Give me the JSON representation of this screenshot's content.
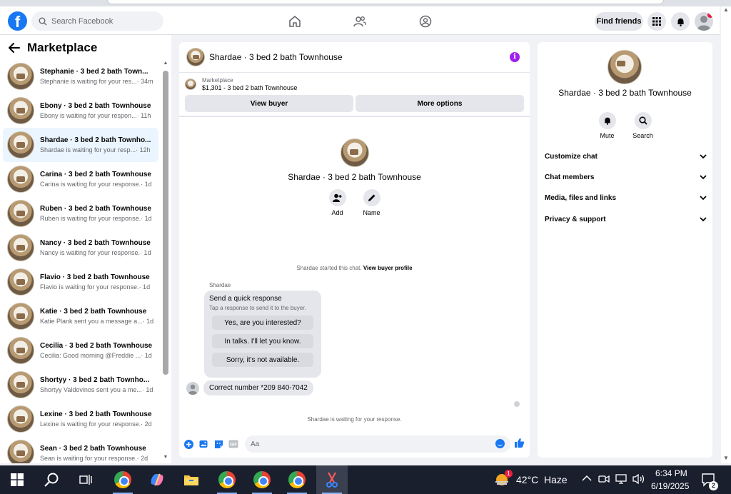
{
  "nav": {
    "search_placeholder": "Search Facebook",
    "logo": "f",
    "find_friends": "Find friends"
  },
  "sidebar": {
    "title": "Marketplace",
    "conversations": [
      {
        "name": "Stephanie · 3 bed 2 bath Town...",
        "msg": "Stephanie is waiting for your res...",
        "time": " · 34m"
      },
      {
        "name": "Ebony · 3 bed 2 bath Townhouse",
        "msg": "Ebony is waiting for your respon...",
        "time": " · 11h"
      },
      {
        "name": "Shardae · 3 bed 2 bath Townho...",
        "msg": "Shardae is waiting for your resp...",
        "time": " · 12h"
      },
      {
        "name": "Carina · 3 bed 2 bath Townhouse",
        "msg": "Carina is waiting for your response.",
        "time": " · 1d"
      },
      {
        "name": "Ruben · 3 bed 2 bath Townhouse",
        "msg": "Ruben is waiting for your response.",
        "time": " · 1d"
      },
      {
        "name": "Nancy · 3 bed 2 bath Townhouse",
        "msg": "Nancy is waiting for your response.",
        "time": " · 1d"
      },
      {
        "name": "Flavio · 3 bed 2 bath Townhouse",
        "msg": "Flavio is waiting for your response.",
        "time": " · 1d"
      },
      {
        "name": "Katie · 3 bed 2 bath Townhouse",
        "msg": "Katie Plank sent you a message a...",
        "time": " · 1d"
      },
      {
        "name": "Cecilia · 3 bed 2 bath Townhouse",
        "msg": "Cecilia: Good morning @Freddie ...",
        "time": " · 1d"
      },
      {
        "name": "Shortyy · 3 bed 2 bath Townho...",
        "msg": "Shortyy Valdovinos sent you a me...",
        "time": " · 1d"
      },
      {
        "name": "Lexine · 3 bed 2 bath Townhouse",
        "msg": "Lexine is waiting for your response.",
        "time": " · 2d"
      },
      {
        "name": "Sean · 3 bed 2 bath Townhouse",
        "msg": "Sean is waiting for your response.",
        "time": " · 2d"
      }
    ]
  },
  "chat": {
    "title": "Shardae · 3 bed 2 bath Townhouse",
    "listing_label": "Marketplace",
    "listing_title": "$1,301 - 3 bed 2 bath Townhouse",
    "view_buyer": "View buyer",
    "more_options": "More options",
    "profile_name": "Shardae · 3 bed 2 bath Townhouse",
    "add_label": "Add",
    "name_label": "Name",
    "started_text": "Shardae started this chat. ",
    "view_buyer_profile": "View buyer profile",
    "sender": "Shardae",
    "quick_title": "Send a quick response",
    "quick_sub": "Tap a response to send it to the buyer.",
    "quick_responses": [
      "Yes, are you interested?",
      "In talks. I'll let you know.",
      "Sorry, it's not available."
    ],
    "message": "Correct number *209 840-7042",
    "waiting": "Shardae is waiting for your response.",
    "composer_placeholder": "Aa",
    "gif": "GIF"
  },
  "details": {
    "name": "Shardae · 3 bed 2 bath Townhouse",
    "mute": "Mute",
    "search": "Search",
    "sections": [
      "Customize chat",
      "Chat members",
      "Media, files and links",
      "Privacy & support"
    ]
  },
  "taskbar": {
    "temperature": "42°C",
    "weather": "Haze",
    "weather_badge": "1",
    "time": "6:34 PM",
    "date": "6/19/2025",
    "notification_count": "2"
  },
  "colors": {
    "brand": "#1877f2",
    "info": "#a020f0"
  }
}
